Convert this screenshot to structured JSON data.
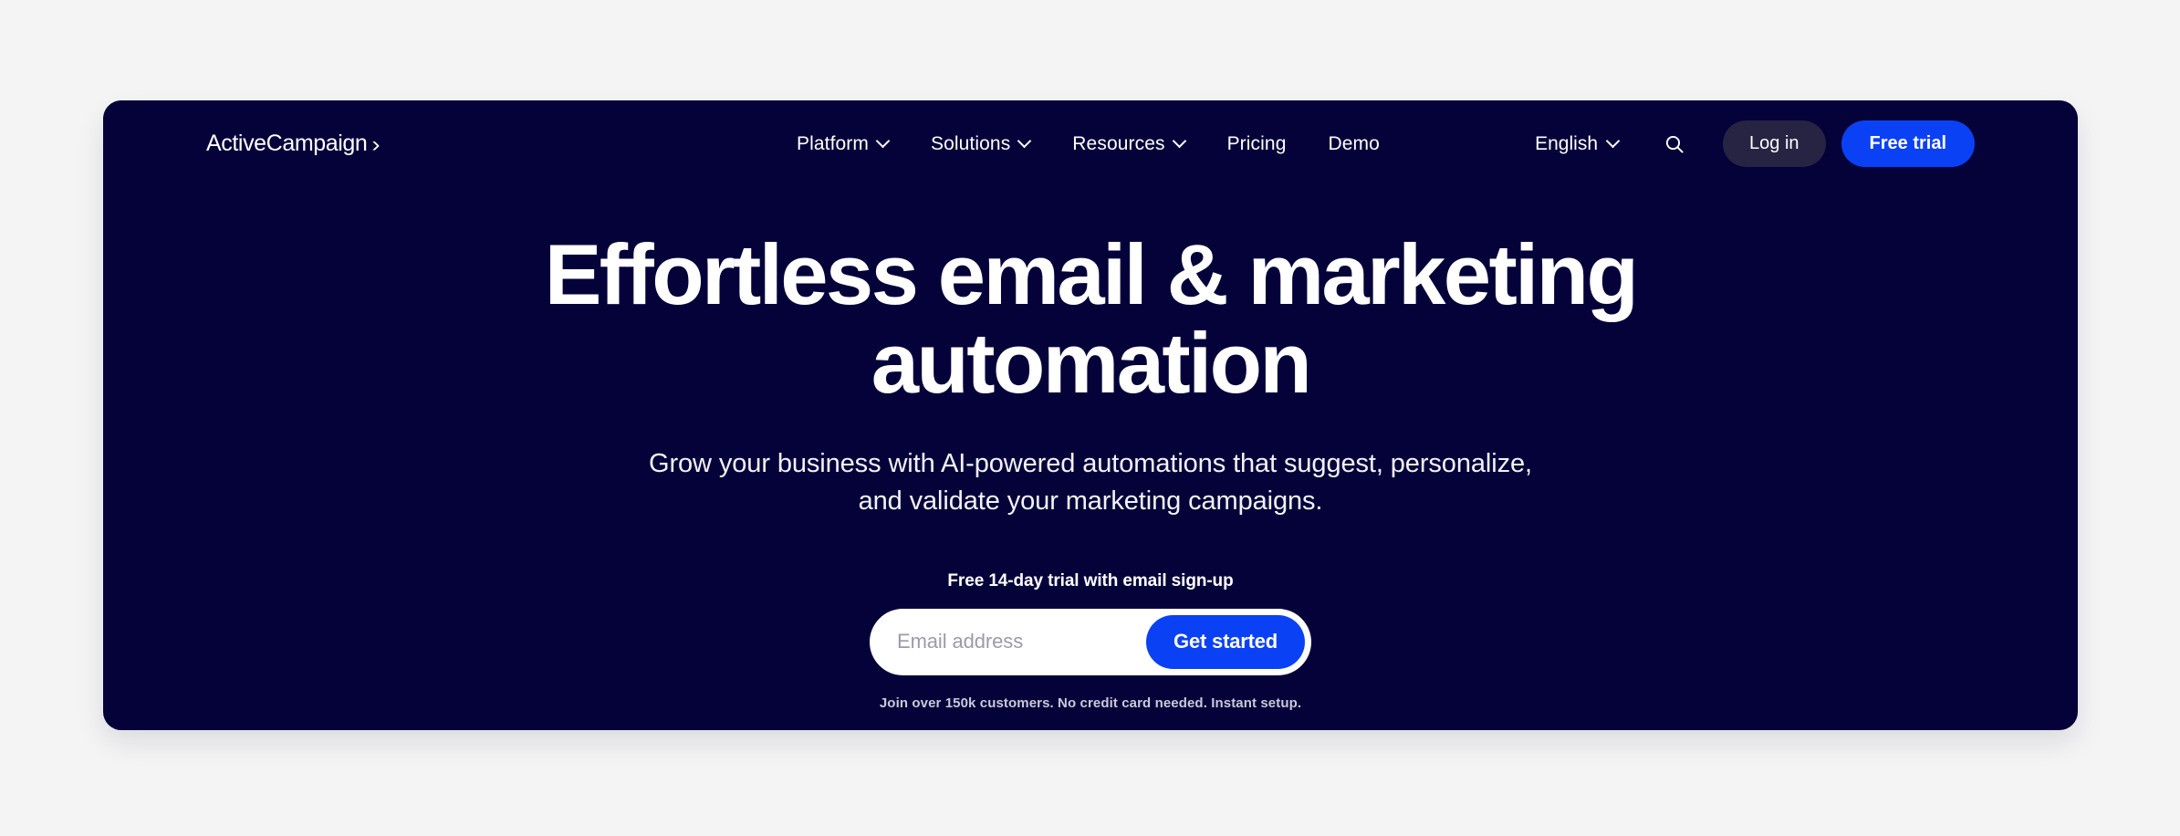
{
  "brand": {
    "name": "ActiveCampaign",
    "mark": "›"
  },
  "nav": {
    "items": [
      {
        "label": "Platform",
        "has_dropdown": true
      },
      {
        "label": "Solutions",
        "has_dropdown": true
      },
      {
        "label": "Resources",
        "has_dropdown": true
      },
      {
        "label": "Pricing",
        "has_dropdown": false
      },
      {
        "label": "Demo",
        "has_dropdown": false
      }
    ]
  },
  "header_right": {
    "language": "English",
    "search_icon": "search-icon",
    "login_label": "Log in",
    "trial_label": "Free trial"
  },
  "hero": {
    "title_line1": "Effortless email & marketing",
    "title_line2": "automation",
    "subtitle_line1": "Grow your business with AI-powered automations that suggest, personalize,",
    "subtitle_line2": "and validate your marketing campaigns.",
    "trial_note": "Free 14-day trial with email sign-up",
    "form": {
      "email_placeholder": "Email address",
      "email_value": "",
      "submit_label": "Get started"
    },
    "form_note": "Join over 150k customers. No credit card needed. Instant setup."
  },
  "colors": {
    "page_background": "#f4f4f5",
    "panel_background": "#05023a",
    "accent_blue": "#0b41f5",
    "login_pill": "#272343",
    "text_white": "#ffffff",
    "muted_text": "#c9c9d8",
    "placeholder": "#9b9bab"
  }
}
